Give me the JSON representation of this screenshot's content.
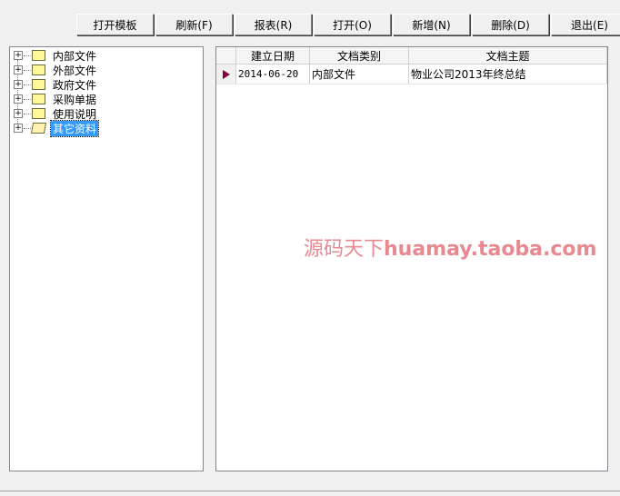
{
  "toolbar": {
    "buttons": [
      "打开模板",
      "刷新(F)",
      "报表(R)",
      "打开(O)",
      "新增(N)",
      "删除(D)",
      "退出(E)"
    ]
  },
  "tree": {
    "items": [
      {
        "label": "内部文件"
      },
      {
        "label": "外部文件"
      },
      {
        "label": "政府文件"
      },
      {
        "label": "采购单据"
      },
      {
        "label": "使用说明"
      },
      {
        "label": "其它资料",
        "selected": true
      }
    ]
  },
  "grid": {
    "columns": [
      "建立日期",
      "文档类别",
      "文档主题"
    ],
    "rows": [
      {
        "date": "2014-06-20",
        "category": "内部文件",
        "subject": "物业公司2013年终总结"
      }
    ]
  },
  "watermark": {
    "cn": "源码天下",
    "url": "huamay.taoba.com"
  }
}
